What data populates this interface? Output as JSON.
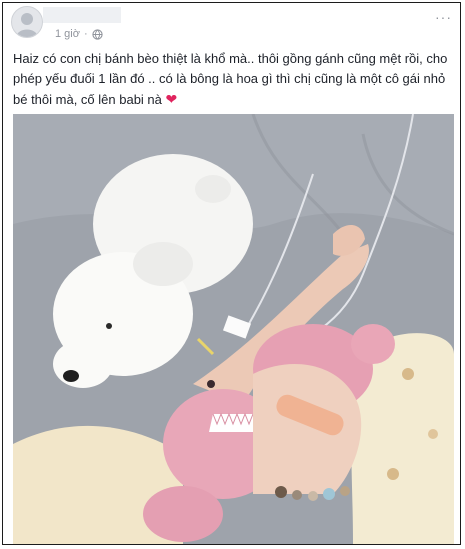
{
  "post": {
    "timestamp": "1 giờ",
    "separator": "·",
    "privacy_icon": "globe-icon",
    "more_icon": "more-options-icon",
    "more_label": "···",
    "text": "Haiz có con chị bánh bèo thiệt là khổ mà.. thôi gồng gánh cũng mệt rồi, cho phép yếu đuối 1 lần đó .. có là bông là hoa gì thì chị cũng là một cô gái nhỏ bé thôi mà, cố lên babi nà",
    "emoji": "❤"
  },
  "colors": {
    "text": "#1d2129",
    "meta": "#90949c",
    "heart": "#e0245e",
    "border": "#1c1c1c"
  }
}
